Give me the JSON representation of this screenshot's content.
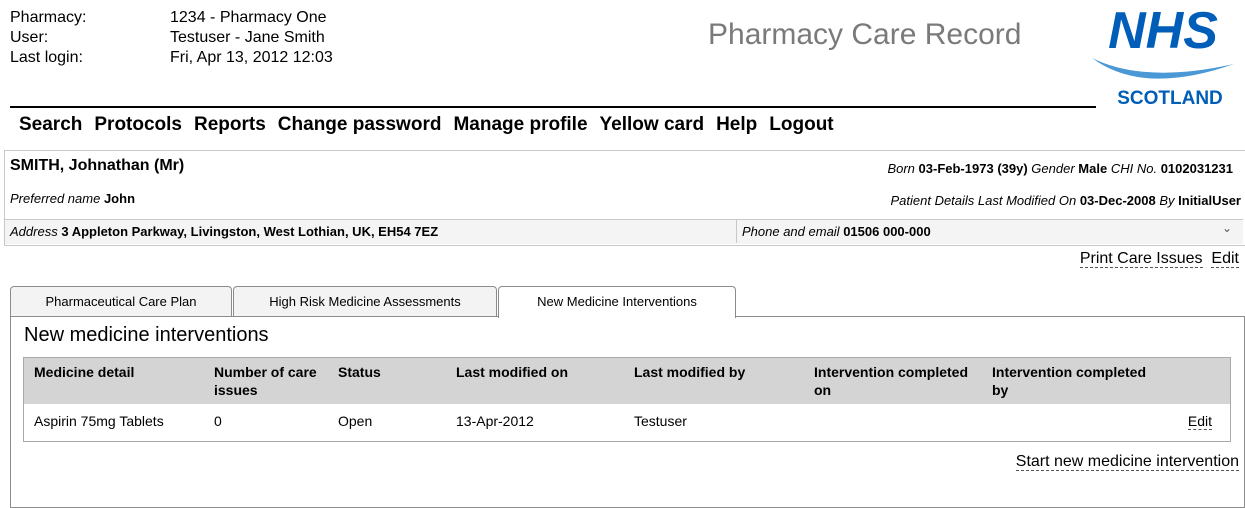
{
  "session": {
    "pharmacy_label": "Pharmacy:",
    "pharmacy_value": "1234 - Pharmacy One",
    "user_label": "User:",
    "user_value": "Testuser - Jane Smith",
    "login_label": "Last login:",
    "login_value": "Fri, Apr 13, 2012 12:03"
  },
  "app_title": "Pharmacy Care Record",
  "logo": {
    "text": "NHS",
    "subtext": "SCOTLAND",
    "color": "#005eb8"
  },
  "nav": [
    "Search",
    "Protocols",
    "Reports",
    "Change password",
    "Manage profile",
    "Yellow card",
    "Help",
    "Logout"
  ],
  "patient": {
    "name": "SMITH, Johnathan (Mr)",
    "born_label": "Born",
    "born_value": "03-Feb-1973",
    "age": "(39y)",
    "gender_label": "Gender",
    "gender_value": "Male",
    "chi_label": "CHI No.",
    "chi_value": "0102031231",
    "preferred_label": "Preferred name",
    "preferred_value": "John",
    "modified_label": "Patient Details Last Modified On",
    "modified_value": "03-Dec-2008",
    "by_label": "By",
    "by_value": "InitialUser",
    "address_label": "Address",
    "address_value": "3 Appleton Parkway, Livingston, West Lothian, UK, EH54 7EZ",
    "phone_label": "Phone and email",
    "phone_value": "01506 000-000"
  },
  "links": {
    "print": "Print Care Issues",
    "edit": "Edit"
  },
  "tabs": [
    "Pharmaceutical Care Plan",
    "High Risk Medicine Assessments",
    "New Medicine Interventions"
  ],
  "section_title": "New medicine interventions",
  "table": {
    "headers": [
      "Medicine detail",
      "Number of care issues",
      "Status",
      "Last modified on",
      "Last modified by",
      "Intervention completed on",
      "Intervention completed by"
    ],
    "rows": [
      {
        "medicine": "Aspirin 75mg Tablets",
        "care_issues": "0",
        "status": "Open",
        "modified_on": "13-Apr-2012",
        "modified_by": "Testuser",
        "completed_on": "",
        "completed_by": "",
        "action": "Edit"
      }
    ]
  },
  "start_link": "Start new medicine intervention"
}
